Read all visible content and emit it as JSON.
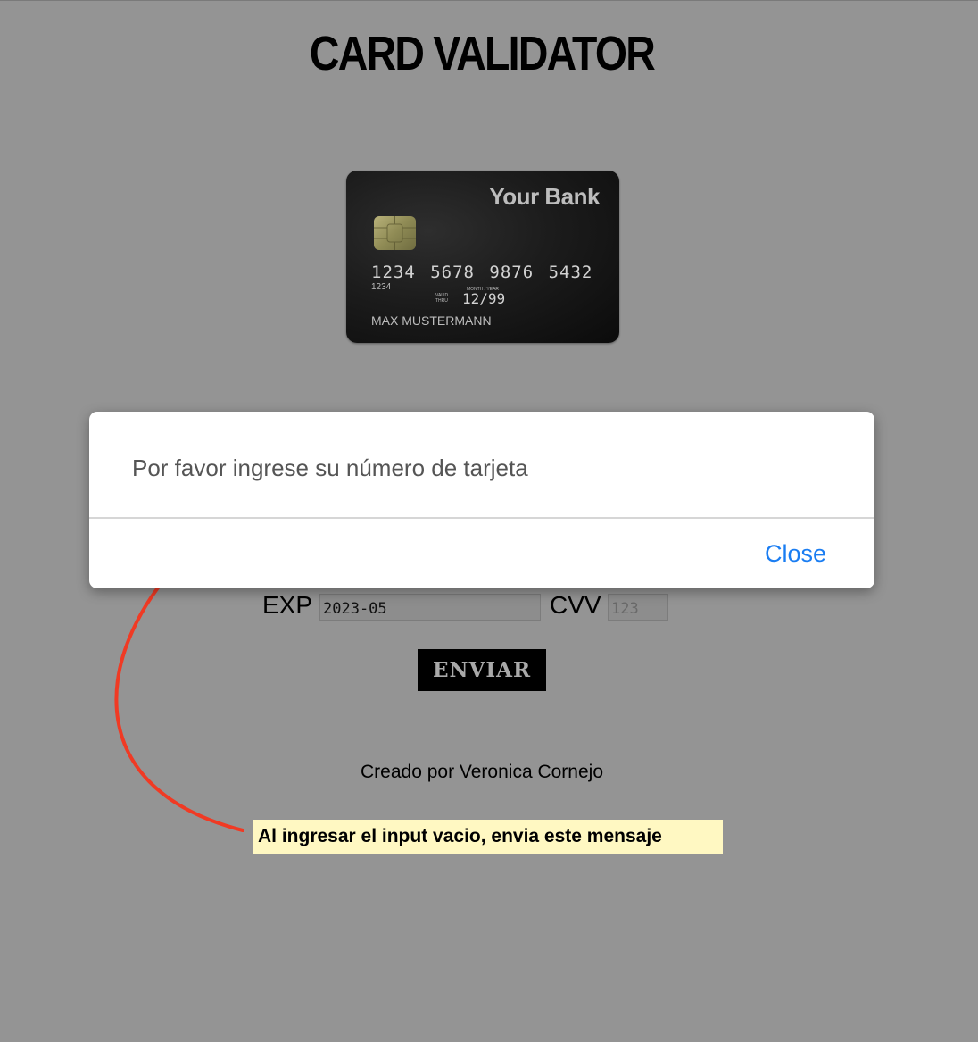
{
  "header": {
    "title": "CARD VALIDATOR"
  },
  "card": {
    "bank_name": "Your Bank",
    "number": "1234 5678 9876 5432",
    "sub_number": "1234",
    "valid_label": "VALID THRU",
    "mmyy_label": "MONTH / YEAR",
    "expiry": "12/99",
    "holder": "MAX MUSTERMANN",
    "chip": "chip-icon"
  },
  "form": {
    "exp_label": "EXP",
    "exp_value": "2023-05",
    "cvv_label": "CVV",
    "cvv_placeholder": "123",
    "submit_label": "ENVIAR"
  },
  "footer": {
    "credit": "Creado por Veronica Cornejo"
  },
  "modal": {
    "message": "Por favor ingrese su número de tarjeta",
    "close_label": "Close"
  },
  "annotation": {
    "note": "Al ingresar el input vacio, envia este mensaje",
    "arrow_color": "#f03a24",
    "note_background": "#fff8c2"
  },
  "colors": {
    "background": "#949494",
    "link_blue": "#1a7df2"
  }
}
